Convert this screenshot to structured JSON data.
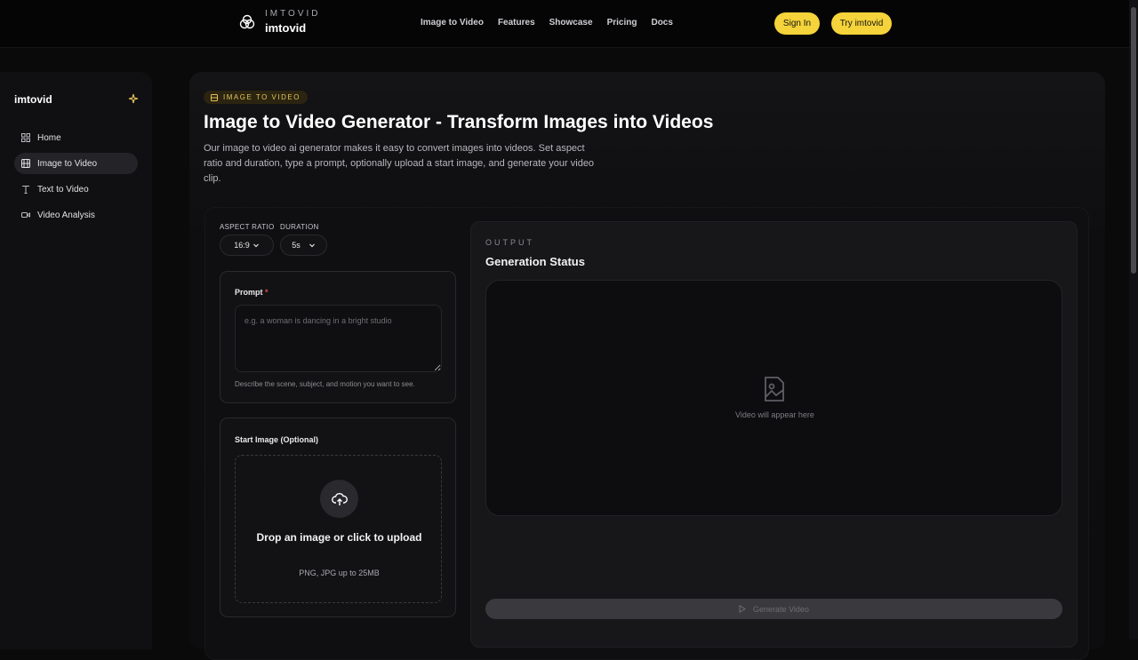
{
  "topnav": {
    "eyebrow": "IMTOVID",
    "brand_name": "imtovid",
    "links": [
      "Image to Video",
      "Features",
      "Showcase",
      "Pricing",
      "Docs"
    ],
    "sign_in": "Sign In",
    "try_label": "Try imtovid"
  },
  "sidebar": {
    "title": "imtovid",
    "items": [
      {
        "label": "Home",
        "icon": "grid-icon"
      },
      {
        "label": "Image to Video",
        "icon": "film-icon",
        "active": true
      },
      {
        "label": "Text to Video",
        "icon": "type-icon"
      },
      {
        "label": "Video Analysis",
        "icon": "video-camera-icon"
      }
    ]
  },
  "main": {
    "tag": "IMAGE TO VIDEO",
    "title": "Image to Video Generator - Transform Images into Videos",
    "description": "Our image to video ai generator makes it easy to convert images into videos. Set aspect ratio and duration, type a prompt, optionally upload a start image, and generate your video clip."
  },
  "form": {
    "aspect_ratio_label": "ASPECT RATIO",
    "aspect_ratio_value": "16:9",
    "duration_label": "DURATION",
    "duration_value": "5s",
    "prompt_label": "Prompt",
    "prompt_required": "*",
    "prompt_placeholder": "e.g. a woman is dancing in a bright studio",
    "prompt_hint": "Describe the scene, subject, and motion you want to see.",
    "start_image_label": "Start Image (Optional)",
    "drop_title": "Drop an image or click to upload",
    "drop_sub": "PNG, JPG up to 25MB"
  },
  "output": {
    "eyebrow": "OUTPUT",
    "title": "Generation Status",
    "placeholder": "Video will appear here",
    "generate_label": "Generate Video"
  },
  "colors": {
    "accent": "#f5d33a",
    "background": "#0a0a0b"
  }
}
